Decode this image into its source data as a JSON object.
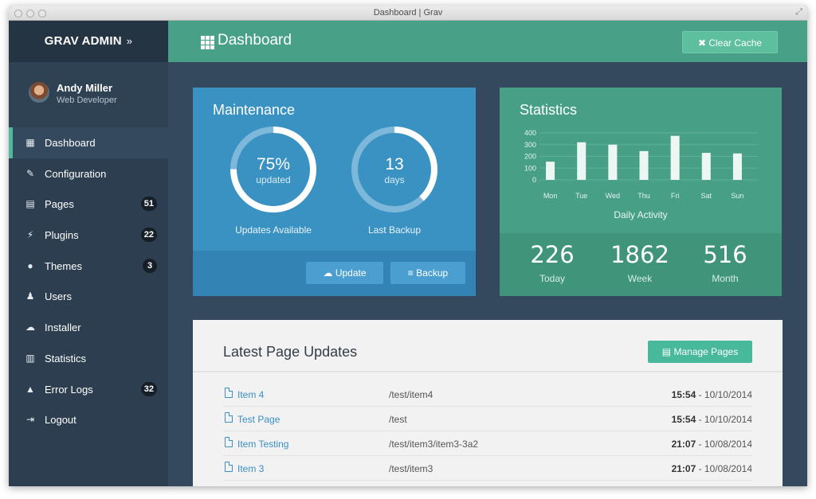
{
  "window": {
    "title": "Dashboard | Grav"
  },
  "sidebar": {
    "brand": "GRAV ADMIN",
    "brand_chevron": "»",
    "user": {
      "name": "Andy Miller",
      "role": "Web Developer"
    },
    "items": [
      {
        "label": "Dashboard",
        "icon": "grid-icon",
        "active": true
      },
      {
        "label": "Configuration",
        "icon": "wrench-icon"
      },
      {
        "label": "Pages",
        "icon": "file-icon",
        "badge": "51"
      },
      {
        "label": "Plugins",
        "icon": "plug-icon",
        "badge": "22"
      },
      {
        "label": "Themes",
        "icon": "tint-icon",
        "badge": "3"
      },
      {
        "label": "Users",
        "icon": "user-icon"
      },
      {
        "label": "Installer",
        "icon": "cloud-download-icon"
      },
      {
        "label": "Statistics",
        "icon": "bar-chart-icon"
      },
      {
        "label": "Error Logs",
        "icon": "warning-icon",
        "badge": "32"
      },
      {
        "label": "Logout",
        "icon": "sign-out-icon"
      }
    ]
  },
  "header": {
    "title": "Dashboard",
    "clear_cache": "Clear Cache"
  },
  "maintenance": {
    "title": "Maintenance",
    "updates": {
      "value": "75%",
      "sub": "updated",
      "caption": "Updates Available",
      "fraction": 0.75
    },
    "backup": {
      "value": "13",
      "sub": "days",
      "caption": "Last Backup",
      "fraction": 0.38
    },
    "update_button": "Update",
    "backup_button": "Backup"
  },
  "statistics": {
    "title": "Statistics",
    "caption": "Daily Activity",
    "today": {
      "value": "226",
      "label": "Today"
    },
    "week": {
      "value": "1862",
      "label": "Week"
    },
    "month": {
      "value": "516",
      "label": "Month"
    }
  },
  "chart_data": {
    "type": "bar",
    "categories": [
      "Mon",
      "Tue",
      "Wed",
      "Thu",
      "Fri",
      "Sat",
      "Sun"
    ],
    "values": [
      155,
      320,
      300,
      245,
      375,
      230,
      225
    ],
    "yticks": [
      0,
      100,
      200,
      300,
      400
    ],
    "ylim": [
      0,
      400
    ],
    "xlabel": "Daily Activity",
    "grid": true
  },
  "updates": {
    "title": "Latest Page Updates",
    "manage_button": "Manage Pages",
    "rows": [
      {
        "title": "Item 4",
        "route": "/test/item4",
        "time": "15:54",
        "date": " - 10/10/2014"
      },
      {
        "title": "Test Page",
        "route": "/test",
        "time": "15:54",
        "date": " - 10/10/2014"
      },
      {
        "title": "Item Testing",
        "route": "/test/item3/item3-3a2",
        "time": "21:07",
        "date": " - 10/08/2014"
      },
      {
        "title": "Item 3",
        "route": "/test/item3",
        "time": "21:07",
        "date": " - 10/08/2014"
      }
    ]
  },
  "colors": {
    "accent": "#48a187",
    "sidebar": "#2c3e50",
    "content": "#34495e",
    "maintenance": "#3a92c3",
    "statistics": "#47a085"
  }
}
